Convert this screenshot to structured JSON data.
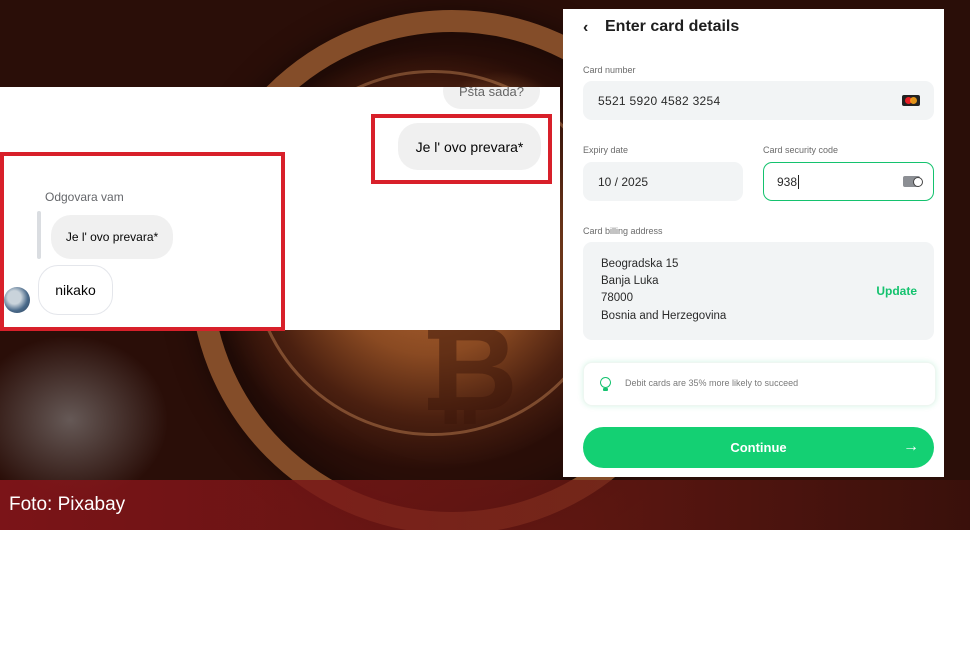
{
  "photo": {
    "caption": "Foto: Pixabay"
  },
  "chat": {
    "top_bubble": "Pšta sada?",
    "sent_message": "Je l' ovo prevara*",
    "reply_label": "Odgovara vam",
    "quoted_message": "Je l' ovo prevara*",
    "received_message": "nikako"
  },
  "card_form": {
    "back_icon": "chevron-left-icon",
    "title": "Enter card details",
    "card_number_label": "Card number",
    "card_number_value": "5521 5920 4582 3254",
    "card_brand_icon": "mastercard-icon",
    "expiry_label": "Expiry date",
    "expiry_value": "10 / 2025",
    "security_label": "Card security code",
    "security_value": "938",
    "security_icon": "cvc-card-icon",
    "billing_label": "Card billing address",
    "address": {
      "line1": "Beogradska 15",
      "line2": "Banja Luka",
      "line3": "78000",
      "line4": "Bosnia and Herzegovina"
    },
    "update_label": "Update",
    "tip_text": "Debit cards are 35% more likely to succeed",
    "continue_label": "Continue",
    "accent_color": "#14d073",
    "highlight_color": "#d8202a"
  }
}
